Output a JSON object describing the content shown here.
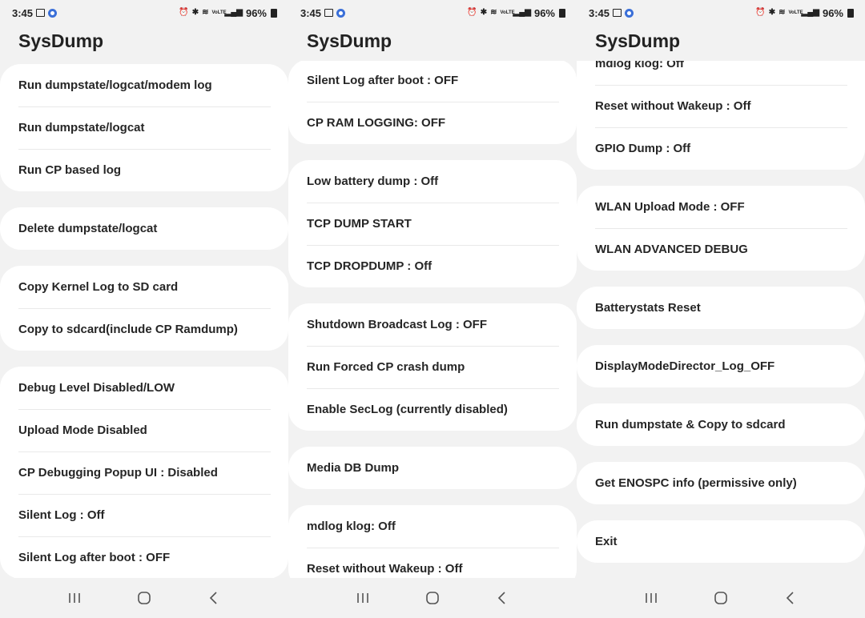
{
  "status_bar": {
    "time": "3:45",
    "network": "VoLTE",
    "battery": "96%"
  },
  "app_title": "SysDump",
  "screens": [
    {
      "cards": [
        [
          "Run dumpstate/logcat/modem log",
          "Run dumpstate/logcat",
          "Run CP based log"
        ],
        [
          "Delete dumpstate/logcat"
        ],
        [
          "Copy Kernel Log to SD card",
          "Copy to sdcard(include CP Ramdump)"
        ],
        [
          "Debug Level Disabled/LOW",
          "Upload Mode Disabled",
          "CP Debugging Popup UI : Disabled",
          "Silent Log : Off",
          "Silent Log after boot : OFF"
        ]
      ]
    },
    {
      "cards": [
        [
          "Silent Log after boot : OFF",
          "CP RAM LOGGING: OFF"
        ],
        [
          "Low battery dump : Off",
          "TCP DUMP START",
          "TCP DROPDUMP : Off"
        ],
        [
          "Shutdown Broadcast Log : OFF",
          "Run Forced CP crash dump",
          "Enable SecLog (currently disabled)"
        ],
        [
          "Media DB Dump"
        ],
        [
          "mdlog klog: Off",
          "Reset without Wakeup : Off"
        ]
      ]
    },
    {
      "cards": [
        [
          "mdlog klog: Off",
          "Reset without Wakeup : Off",
          "GPIO Dump : Off"
        ],
        [
          "WLAN Upload Mode : OFF",
          "WLAN ADVANCED DEBUG"
        ],
        [
          "Batterystats Reset"
        ],
        [
          "DisplayModeDirector_Log_OFF"
        ],
        [
          "Run dumpstate & Copy to sdcard"
        ],
        [
          "Get ENOSPC info (permissive only)"
        ],
        [
          "Exit"
        ]
      ]
    }
  ],
  "nav": {
    "icons": [
      "recents-icon",
      "home-icon",
      "back-icon"
    ]
  },
  "colors": {
    "background": "#f2f2f2",
    "card": "#ffffff",
    "text": "#262626",
    "divider": "#e9e9e9"
  }
}
